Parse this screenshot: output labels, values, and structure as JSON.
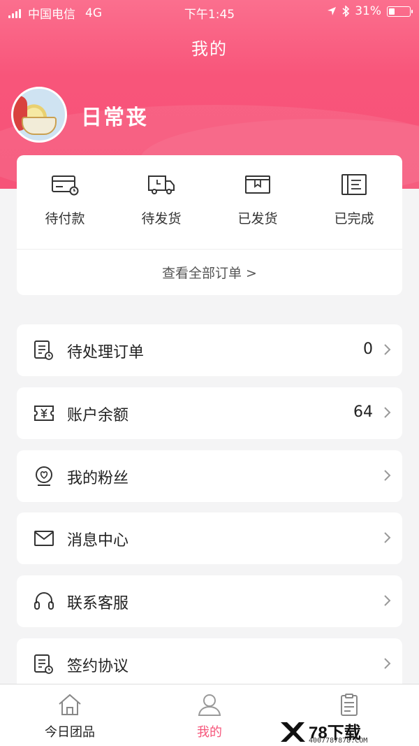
{
  "status_bar": {
    "carrier": "中国电信",
    "network": "4G",
    "time": "下午1:45",
    "battery": "31%",
    "battery_level": 0.31
  },
  "nav": {
    "title": "我的"
  },
  "profile": {
    "username": "日常丧"
  },
  "orders": {
    "items": [
      {
        "label": "待付款",
        "icon": "card-clock-icon"
      },
      {
        "label": "待发货",
        "icon": "truck-icon"
      },
      {
        "label": "已发货",
        "icon": "package-icon"
      },
      {
        "label": "已完成",
        "icon": "list-doc-icon"
      }
    ],
    "view_all": "查看全部订单 >"
  },
  "menu": [
    {
      "label": "待处理订单",
      "value": "0",
      "icon": "pending-order-icon"
    },
    {
      "label": "账户余额",
      "value": "64",
      "icon": "balance-icon"
    },
    {
      "label": "我的粉丝",
      "value": "",
      "icon": "fans-icon"
    },
    {
      "label": "消息中心",
      "value": "",
      "icon": "mail-icon"
    },
    {
      "label": "联系客服",
      "value": "",
      "icon": "headset-icon"
    },
    {
      "label": "签约协议",
      "value": "",
      "icon": "agreement-icon"
    }
  ],
  "tabbar": [
    {
      "label": "今日团品",
      "icon": "home-icon",
      "active": false
    },
    {
      "label": "我的",
      "icon": "user-icon",
      "active": true
    },
    {
      "label": "",
      "icon": "clipboard-icon",
      "active": false
    }
  ],
  "watermark": {
    "brand": "78下载",
    "phone": "4007787878.COM"
  },
  "colors": {
    "accent": "#f6567b",
    "text": "#222222",
    "background": "#f4f4f5",
    "tab_active": "#f6567b",
    "tab_inactive": "#222222"
  }
}
